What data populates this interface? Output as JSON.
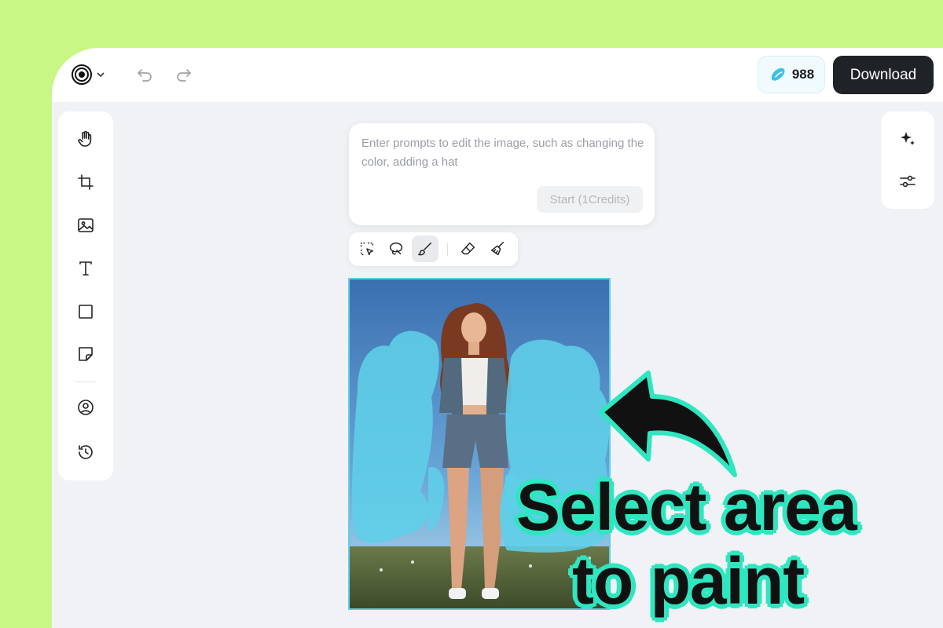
{
  "topbar": {
    "credits": "988",
    "download_label": "Download",
    "icons": [
      "spiral-logo-icon",
      "chevron-down-icon",
      "undo-icon",
      "redo-icon",
      "credit-gem-icon"
    ]
  },
  "left_toolbar": {
    "tools": [
      "hand-icon",
      "crop-icon",
      "image-icon",
      "text-icon",
      "rectangle-icon",
      "sticky-note-icon",
      "user-circle-icon",
      "history-icon"
    ]
  },
  "right_toolbar": {
    "tools": [
      "sparkles-icon",
      "sliders-icon"
    ]
  },
  "prompt": {
    "placeholder": "Enter prompts to edit the image, such as changing the color, adding a hat",
    "value": "",
    "start_label": "Start (1Credits)"
  },
  "selection_tools": {
    "tools": [
      "rect-select-icon",
      "lasso-icon",
      "brush-icon",
      "eraser-icon",
      "clear-brush-icon"
    ],
    "active": "brush-icon"
  },
  "overlay": {
    "line1": "Select area",
    "line2": "to paint"
  },
  "colors": {
    "background": "#c8f786",
    "mask": "#5ecfe8",
    "accent_text_outline": "#2ee6c0",
    "download_bg": "#1f2227"
  }
}
